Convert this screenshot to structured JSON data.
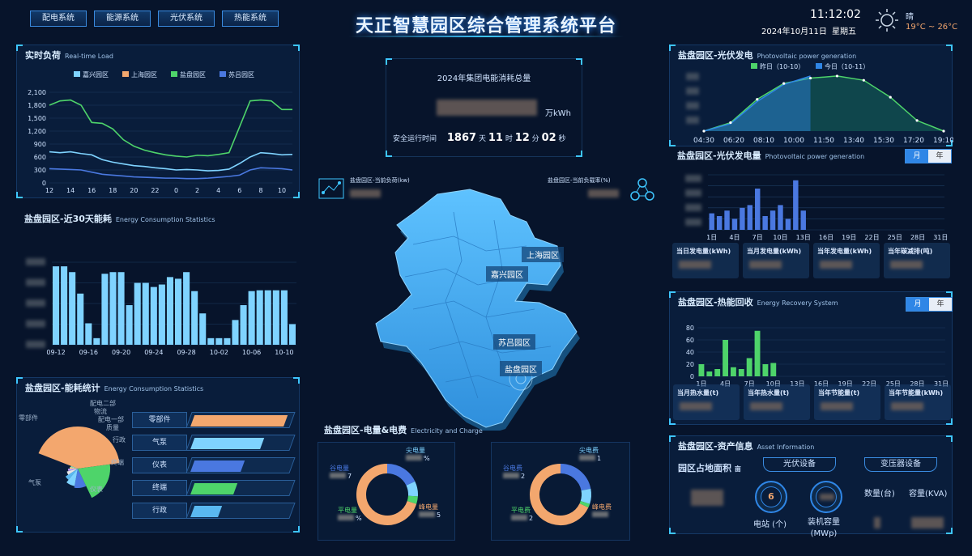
{
  "nav": [
    "配电系统",
    "能源系统",
    "光伏系统",
    "热能系统"
  ],
  "title": "天正智慧园区综合管理系统平台",
  "clock": {
    "time": "11:12:02",
    "date": "2024年10月11日",
    "weekday": "星期五",
    "weather": "晴",
    "temp": "19°C ~ 26°C"
  },
  "realtime": {
    "title": "实时负荷",
    "subtitle": "Real-time Load",
    "legend": [
      {
        "name": "嘉兴园区",
        "color": "#7fd3ff"
      },
      {
        "name": "上海园区",
        "color": "#f3a76e"
      },
      {
        "name": "盐盘园区",
        "color": "#4ed46a"
      },
      {
        "name": "苏吕园区",
        "color": "#4a78e0"
      }
    ],
    "yticks": [
      "2,100",
      "1,800",
      "1,500",
      "1,200",
      "900",
      "600",
      "300",
      "0"
    ],
    "xticks": [
      "12",
      "14",
      "16",
      "18",
      "20",
      "22",
      "0",
      "2",
      "4",
      "6",
      "8",
      "10"
    ]
  },
  "consumption30": {
    "title": "盐盘园区-近30天能耗",
    "subtitle": "Energy Consumption Statistics",
    "xticks": [
      "09-12",
      "09-16",
      "09-20",
      "09-24",
      "09-28",
      "10-02",
      "10-06",
      "10-10"
    ]
  },
  "energyStats": {
    "title": "盐盘园区-能耗统计",
    "subtitle": "Energy Consumption Statistics",
    "pieLabels": [
      "配电二部",
      "物流",
      "配电一部",
      "质量",
      "零部件",
      "行政",
      "终端",
      "气泵",
      "仪表"
    ],
    "bars": [
      {
        "label": "零部件",
        "pct": 0.96,
        "color": "#f3a76e"
      },
      {
        "label": "气泵",
        "pct": 0.72,
        "color": "#7fd3ff"
      },
      {
        "label": "仪表",
        "pct": 0.52,
        "color": "#4a78e0"
      },
      {
        "label": "终端",
        "pct": 0.44,
        "color": "#4ed46a"
      },
      {
        "label": "行政",
        "pct": 0.28,
        "color": "#5ab8f0"
      }
    ]
  },
  "center": {
    "statTitle": "2024年集团电能消耗总量",
    "unit": "万kWh",
    "runtimeLabel": "安全运行时间",
    "days": "1867",
    "dayUnit": "天",
    "hours": "11",
    "hourUnit": "时",
    "minutes": "12",
    "minUnit": "分",
    "seconds": "02",
    "secUnit": "秒",
    "loadLabel": "盐盘园区-当前负荷(kw)",
    "rateLabel": "盐盘园区-当前负载率(%)",
    "map": [
      "上海园区",
      "嘉兴园区",
      "苏吕园区",
      "盐盘园区"
    ]
  },
  "elec": {
    "title": "盐盘园区-电量&电费",
    "subtitle": "Electricity and Charge",
    "left": [
      "谷电量",
      "尖电量",
      "平电量",
      "峰电量"
    ],
    "right": [
      "谷电费",
      "尖电费",
      "平电费",
      "峰电费"
    ],
    "leftPartial": [
      "7",
      "%",
      "%",
      "5"
    ],
    "rightPartial": [
      "2",
      "1",
      "2",
      ""
    ]
  },
  "pv": {
    "title": "盐盘园区-光伏发电",
    "subtitle": "Photovoltaic power generation",
    "legend": [
      "昨日（10-10）",
      "今日（10-11）"
    ],
    "xticks": [
      "04:30",
      "06:20",
      "08:10",
      "10:00",
      "11:50",
      "13:40",
      "15:30",
      "17:20",
      "19:10"
    ]
  },
  "pvGen": {
    "title": "盐盘园区-光伏发电量",
    "subtitle": "Photovoltaic power generation",
    "toggle": [
      "月",
      "年"
    ],
    "xticks": [
      "1日",
      "4日",
      "7日",
      "10日",
      "13日",
      "16日",
      "19日",
      "22日",
      "25日",
      "28日",
      "31日"
    ],
    "stats": [
      "当日发电量(kWh)",
      "当月发电量(kWh)",
      "当年发电量(kWh)",
      "当年碳减排(吨)"
    ]
  },
  "heat": {
    "title": "盐盘园区-热能回收",
    "subtitle": "Energy Recovery System",
    "toggle": [
      "月",
      "年"
    ],
    "yticks": [
      "80",
      "60",
      "40",
      "20",
      "0"
    ],
    "xticks": [
      "1日",
      "4日",
      "7日",
      "10日",
      "13日",
      "16日",
      "19日",
      "22日",
      "25日",
      "28日",
      "31日"
    ],
    "stats": [
      "当月热水量(t)",
      "当年热水量(t)",
      "当年节能量(t)",
      "当年节能量(kWh)"
    ]
  },
  "asset": {
    "title": "盐盘园区-资产信息",
    "subtitle": "Asset Information",
    "areaLabel": "园区占地面积",
    "areaUnit": "亩",
    "pvTab": "光伏设备",
    "trTab": "变压器设备",
    "stationCount": "6",
    "stationLabel": "电站 (个)",
    "capLabel": "装机容量",
    "capUnit": "(MWp)",
    "qtyLabel": "数量(台)",
    "kvaLabel": "容量(KVA)"
  },
  "chart_data": [
    {
      "type": "line",
      "title": "实时负荷",
      "x": [
        "12",
        "13",
        "14",
        "15",
        "16",
        "17",
        "18",
        "19",
        "20",
        "21",
        "22",
        "23",
        "0",
        "1",
        "2",
        "3",
        "4",
        "5",
        "6",
        "7",
        "8",
        "9",
        "10",
        "11"
      ],
      "series": [
        {
          "name": "嘉兴园区",
          "values": [
            720,
            700,
            720,
            680,
            650,
            540,
            480,
            440,
            400,
            380,
            350,
            330,
            300,
            310,
            300,
            280,
            290,
            320,
            450,
            600,
            700,
            680,
            650,
            660
          ]
        },
        {
          "name": "上海园区",
          "values": [
            null
          ]
        },
        {
          "name": "盐盘园区",
          "values": [
            1800,
            1900,
            1920,
            1800,
            1400,
            1380,
            1250,
            1000,
            850,
            760,
            700,
            650,
            620,
            600,
            640,
            630,
            660,
            700,
            1300,
            1900,
            1920,
            1900,
            1700,
            1700
          ]
        },
        {
          "name": "苏吕园区",
          "values": [
            330,
            320,
            310,
            300,
            250,
            200,
            180,
            160,
            140,
            130,
            120,
            110,
            110,
            100,
            100,
            110,
            130,
            150,
            180,
            300,
            350,
            340,
            330,
            300
          ]
        }
      ],
      "ylim": [
        0,
        2100
      ]
    },
    {
      "type": "bar",
      "title": "盐盘园区-近30天能耗",
      "values": [
        95,
        95,
        88,
        62,
        26,
        8,
        86,
        88,
        88,
        48,
        75,
        75,
        70,
        73,
        82,
        80,
        88,
        65,
        38,
        8,
        8,
        8,
        30,
        48,
        65,
        66,
        66,
        66,
        66,
        25
      ]
    },
    {
      "type": "pie",
      "title": "盐盘园区-能耗统计",
      "categories": [
        "零部件",
        "气泵",
        "仪表",
        "终端",
        "行政",
        "质量",
        "配电一部",
        "物流",
        "配电二部"
      ],
      "values": [
        42,
        20,
        10,
        8,
        5,
        5,
        4,
        3,
        3
      ]
    },
    {
      "type": "line",
      "title": "盐盘园区-光伏发电",
      "series": [
        {
          "name": "昨日（10-10）",
          "values": [
            0,
            8,
            30,
            45,
            50,
            52,
            48,
            32,
            10,
            0
          ]
        },
        {
          "name": "今日（10-11）",
          "values": [
            0,
            7,
            28,
            44,
            52
          ]
        }
      ]
    },
    {
      "type": "bar",
      "title": "盐盘园区-光伏发电量",
      "values": [
        12,
        10,
        14,
        8,
        16,
        18,
        30,
        10,
        14,
        18,
        8,
        36,
        14
      ]
    },
    {
      "type": "bar",
      "title": "盐盘园区-热能回收",
      "categories": [
        "1日",
        "2日",
        "3日",
        "4日",
        "5日",
        "6日",
        "7日",
        "8日",
        "9日",
        "10日",
        "11日"
      ],
      "values": [
        20,
        8,
        12,
        60,
        15,
        12,
        30,
        75,
        20,
        22,
        0
      ],
      "ylim": [
        0,
        80
      ]
    }
  ]
}
